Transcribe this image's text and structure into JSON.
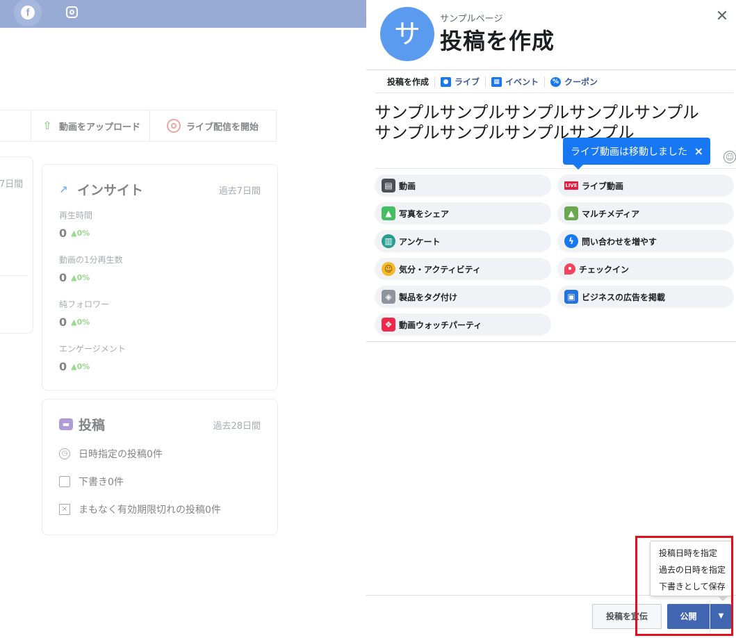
{
  "background": {
    "toolbar": {
      "upload_label": "動画をアップロード",
      "live_label": "ライブ配信を開始"
    },
    "left_card": {
      "period": "7日間"
    },
    "insights": {
      "title": "インサイト",
      "period": "過去7日間",
      "metrics": [
        {
          "label": "再生時間",
          "value": "0",
          "change": "▲0%"
        },
        {
          "label": "動画の1分再生数",
          "value": "0",
          "change": "▲0%"
        },
        {
          "label": "純フォロワー",
          "value": "0",
          "change": "▲0%"
        },
        {
          "label": "エンゲージメント",
          "value": "0",
          "change": "▲0%"
        }
      ]
    },
    "posts": {
      "title": "投稿",
      "period": "過去28日間",
      "rows": [
        {
          "icon": "clock-icon",
          "label": "日時指定の投稿0件"
        },
        {
          "icon": "document-icon",
          "label": "下書き0件"
        },
        {
          "icon": "expire-icon",
          "label": "まもなく有効期限切れの投稿0件"
        }
      ]
    }
  },
  "modal": {
    "avatar_letter": "サ",
    "page_name": "サンプルページ",
    "title": "投稿を作成",
    "tabs": [
      {
        "label": "投稿を作成",
        "icon": ""
      },
      {
        "label": "ライブ",
        "icon": "live-camera-icon"
      },
      {
        "label": "イベント",
        "icon": "calendar-icon"
      },
      {
        "label": "クーポン",
        "icon": "coupon-icon"
      }
    ],
    "post_text": "サンプルサンプルサンプルサンプルサンプルサンプルサンプルサンプルサンプル",
    "tooltip": {
      "text": "ライブ動画は移動しました",
      "close": "×"
    },
    "options": [
      {
        "label": "動画",
        "icon": "clapperboard-icon",
        "color": "#4b4f56"
      },
      {
        "label": "ライブ動画",
        "icon": "live-badge-icon",
        "color": "#e41e3f"
      },
      {
        "label": "写真をシェア",
        "icon": "photo-icon",
        "color": "#45bd62"
      },
      {
        "label": "マルチメディア",
        "icon": "multimedia-icon",
        "color": "#6aa84f"
      },
      {
        "label": "アンケート",
        "icon": "poll-icon",
        "color": "#2a9d8f"
      },
      {
        "label": "問い合わせを増やす",
        "icon": "messenger-icon",
        "color": "#1877f2"
      },
      {
        "label": "気分・アクティビティ",
        "icon": "smiley-icon",
        "color": "#f7b928"
      },
      {
        "label": "チェックイン",
        "icon": "location-pin-icon",
        "color": "#f3425f"
      },
      {
        "label": "製品をタグ付け",
        "icon": "tag-icon",
        "color": "#8d949e"
      },
      {
        "label": "ビジネスの広告を掲載",
        "icon": "ad-icon",
        "color": "#2374e1"
      },
      {
        "label": "動画ウォッチパーティ",
        "icon": "popcorn-icon",
        "color": "#f0284a"
      }
    ],
    "dropdown": {
      "items": [
        "投稿日時を指定",
        "過去の日時を指定",
        "下書きとして保存"
      ]
    },
    "buttons": {
      "preview": "投稿を宣伝",
      "publish": "公開"
    }
  },
  "colors": {
    "topbar": "#4267b2",
    "primary": "#1877f2",
    "publish": "#4267b2",
    "highlight": "#e0101c"
  }
}
